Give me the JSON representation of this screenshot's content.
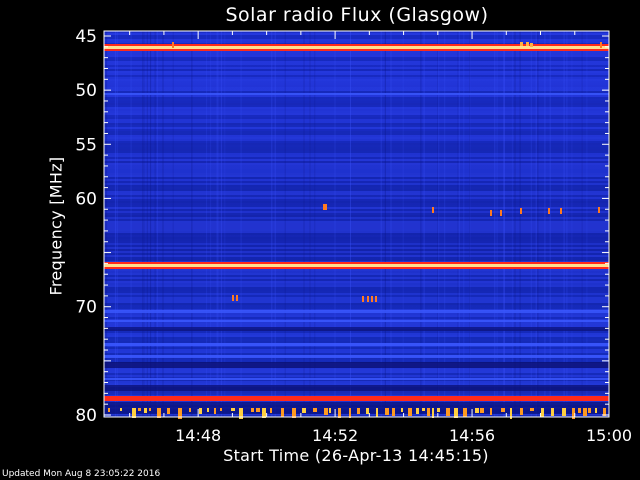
{
  "chart_data": {
    "type": "heatmap",
    "title": "Solar radio Flux (Glasgow)",
    "xlabel": "Start Time (26-Apr-13 14:45:15)",
    "ylabel": "Frequency [MHz]",
    "x_ticks": [
      "14:48",
      "14:52",
      "14:56",
      "15:00"
    ],
    "y_ticks": [
      "45",
      "50",
      "55",
      "60",
      "70",
      "80"
    ],
    "footer": "Updated Mon Aug  8 23:05:22 2016",
    "colors": {
      "background": "#000000",
      "low": "#0a1a8f",
      "mid": "#2f3ff0",
      "high": "#ff2a1a",
      "peak": "#ffe9a0"
    }
  }
}
